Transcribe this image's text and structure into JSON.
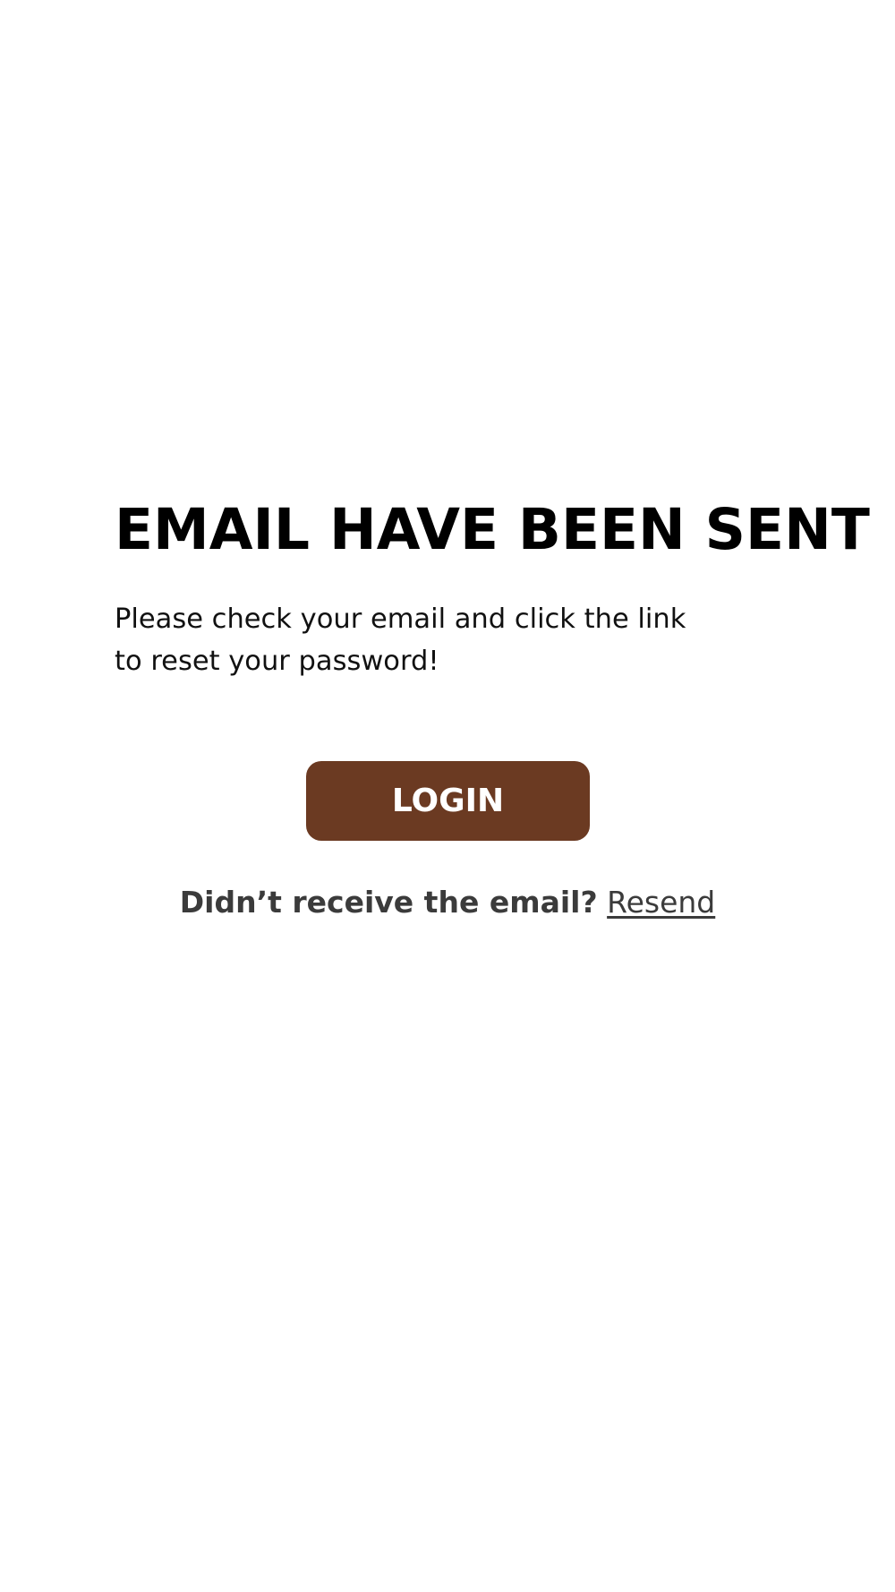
{
  "page": {
    "title": "EMAIL HAVE BEEN SENT",
    "message_line_1": "Please check your email and click the link",
    "message_line_2": "to reset your password!"
  },
  "actions": {
    "login_label": "LOGIN",
    "resend_prompt": "Didn’t receive the email?",
    "resend_label": "Resend"
  },
  "colors": {
    "background": "#ffffff",
    "title_text": "#000000",
    "button_background": "#6b3a22",
    "button_text": "#ffffff",
    "secondary_text": "#3b3b3b"
  }
}
